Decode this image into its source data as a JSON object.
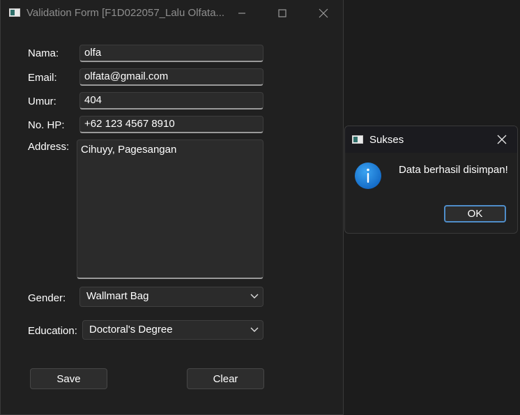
{
  "main_window": {
    "title": "Validation Form [F1D022057_Lalu Olfata...",
    "minimize_icon": "minimize-icon",
    "maximize_icon": "maximize-icon",
    "close_icon": "close-icon"
  },
  "form": {
    "name": {
      "label": "Nama:",
      "value": "olfa"
    },
    "email": {
      "label": "Email:",
      "value": "olfata@gmail.com"
    },
    "age": {
      "label": "Umur:",
      "value": "404"
    },
    "phone": {
      "label": "No. HP:",
      "value": "+62 123 4567 8910"
    },
    "address": {
      "label": "Address:",
      "value": "Cihuyy, Pagesangan"
    },
    "gender": {
      "label": "Gender:",
      "selected": "Wallmart Bag"
    },
    "education": {
      "label": "Education:",
      "selected": "Doctoral's Degree"
    }
  },
  "buttons": {
    "save": "Save",
    "clear": "Clear"
  },
  "dialog": {
    "title": "Sukses",
    "message": "Data berhasil disimpan!",
    "ok_label": "OK",
    "icon": "info-icon"
  },
  "colors": {
    "window_bg": "#202020",
    "field_bg": "#2b2b2b",
    "accent": "#4f8dc9",
    "info_blue": "#1e7fd6"
  }
}
